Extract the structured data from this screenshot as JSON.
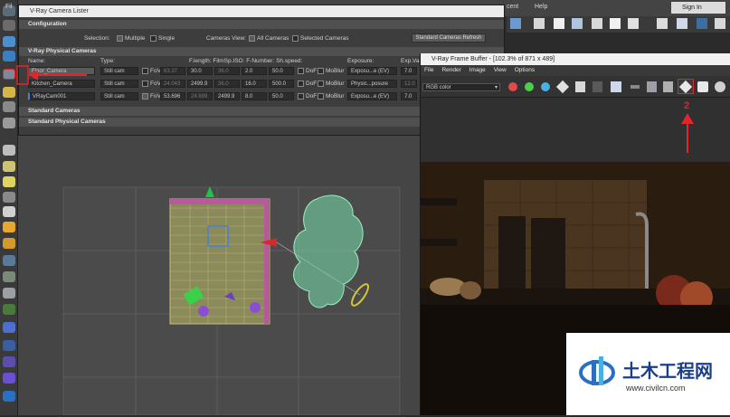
{
  "menu": {
    "file_stub": "Fil",
    "ent_stub": "cent",
    "help": "Help",
    "sign_in": "Sign In"
  },
  "lister": {
    "title": "V-Ray Camera Lister",
    "configuration": "Configuration",
    "selection_label": "Selection:",
    "multiple": "Multiple",
    "single": "Single",
    "cameras_view_label": "Cameras View:",
    "all_cameras": "All Cameras",
    "selected_cameras": "Selected Cameras",
    "refresh_button": "Standard Cameras Refresh",
    "vray_physical_cameras": "V-Ray Physical Cameras",
    "standard_cameras": "Standard Cameras",
    "standard_physical_cameras": "Standard Physical Cameras",
    "columns": [
      "Name:",
      "Type:",
      "F.length: FilmSp.ISO: F-Number: Sh.speed:",
      "Exposure:",
      "Exp.Va"
    ],
    "rows": [
      {
        "name": "Floor_Camera",
        "type": "Still cam",
        "fov_chk": "FoV",
        "fov": "63.37",
        "flen": "30.0",
        "film": "36.0",
        "iso": "2.0",
        "fnum": "50.0",
        "dof": "DoF",
        "mb": "MoBlur",
        "exposure": "Exposu...e (EV)",
        "expval": "7.0"
      },
      {
        "name": "Kitchen_Camera",
        "type": "Still cam",
        "fov_chk": "FoV",
        "fov": "24.043",
        "flen": "2499.9",
        "film": "36.0",
        "iso": "16.0",
        "fnum": "500.0",
        "dof": "DoF",
        "mb": "MoBlur",
        "exposure": "Physic...posure",
        "expval": "12.0"
      },
      {
        "name": "VRayCam001",
        "type": "Still cam",
        "fov_chk": "FoV",
        "fov": "53.696",
        "flen": "24.699",
        "film": "2499.9",
        "iso": "8.0",
        "fnum": "50.0",
        "dof": "DoF",
        "mb": "MoBlur",
        "exposure": "Exposu...e (EV)",
        "expval": "7.0"
      }
    ]
  },
  "vfb": {
    "title": "V-Ray Frame Buffer - [102.3% of 871 x 489]",
    "menus": [
      "File",
      "Render",
      "Image",
      "View",
      "Options"
    ],
    "channel": "RGB color",
    "annotation_number": "2"
  },
  "colors": {
    "annotation_red": "#e0262b",
    "wireframe_green": "#9cf0c0",
    "grid_yellow": "#c9c27a"
  },
  "watermark": {
    "cn_text": "土木工程网",
    "url": "www.civilcn.com"
  }
}
